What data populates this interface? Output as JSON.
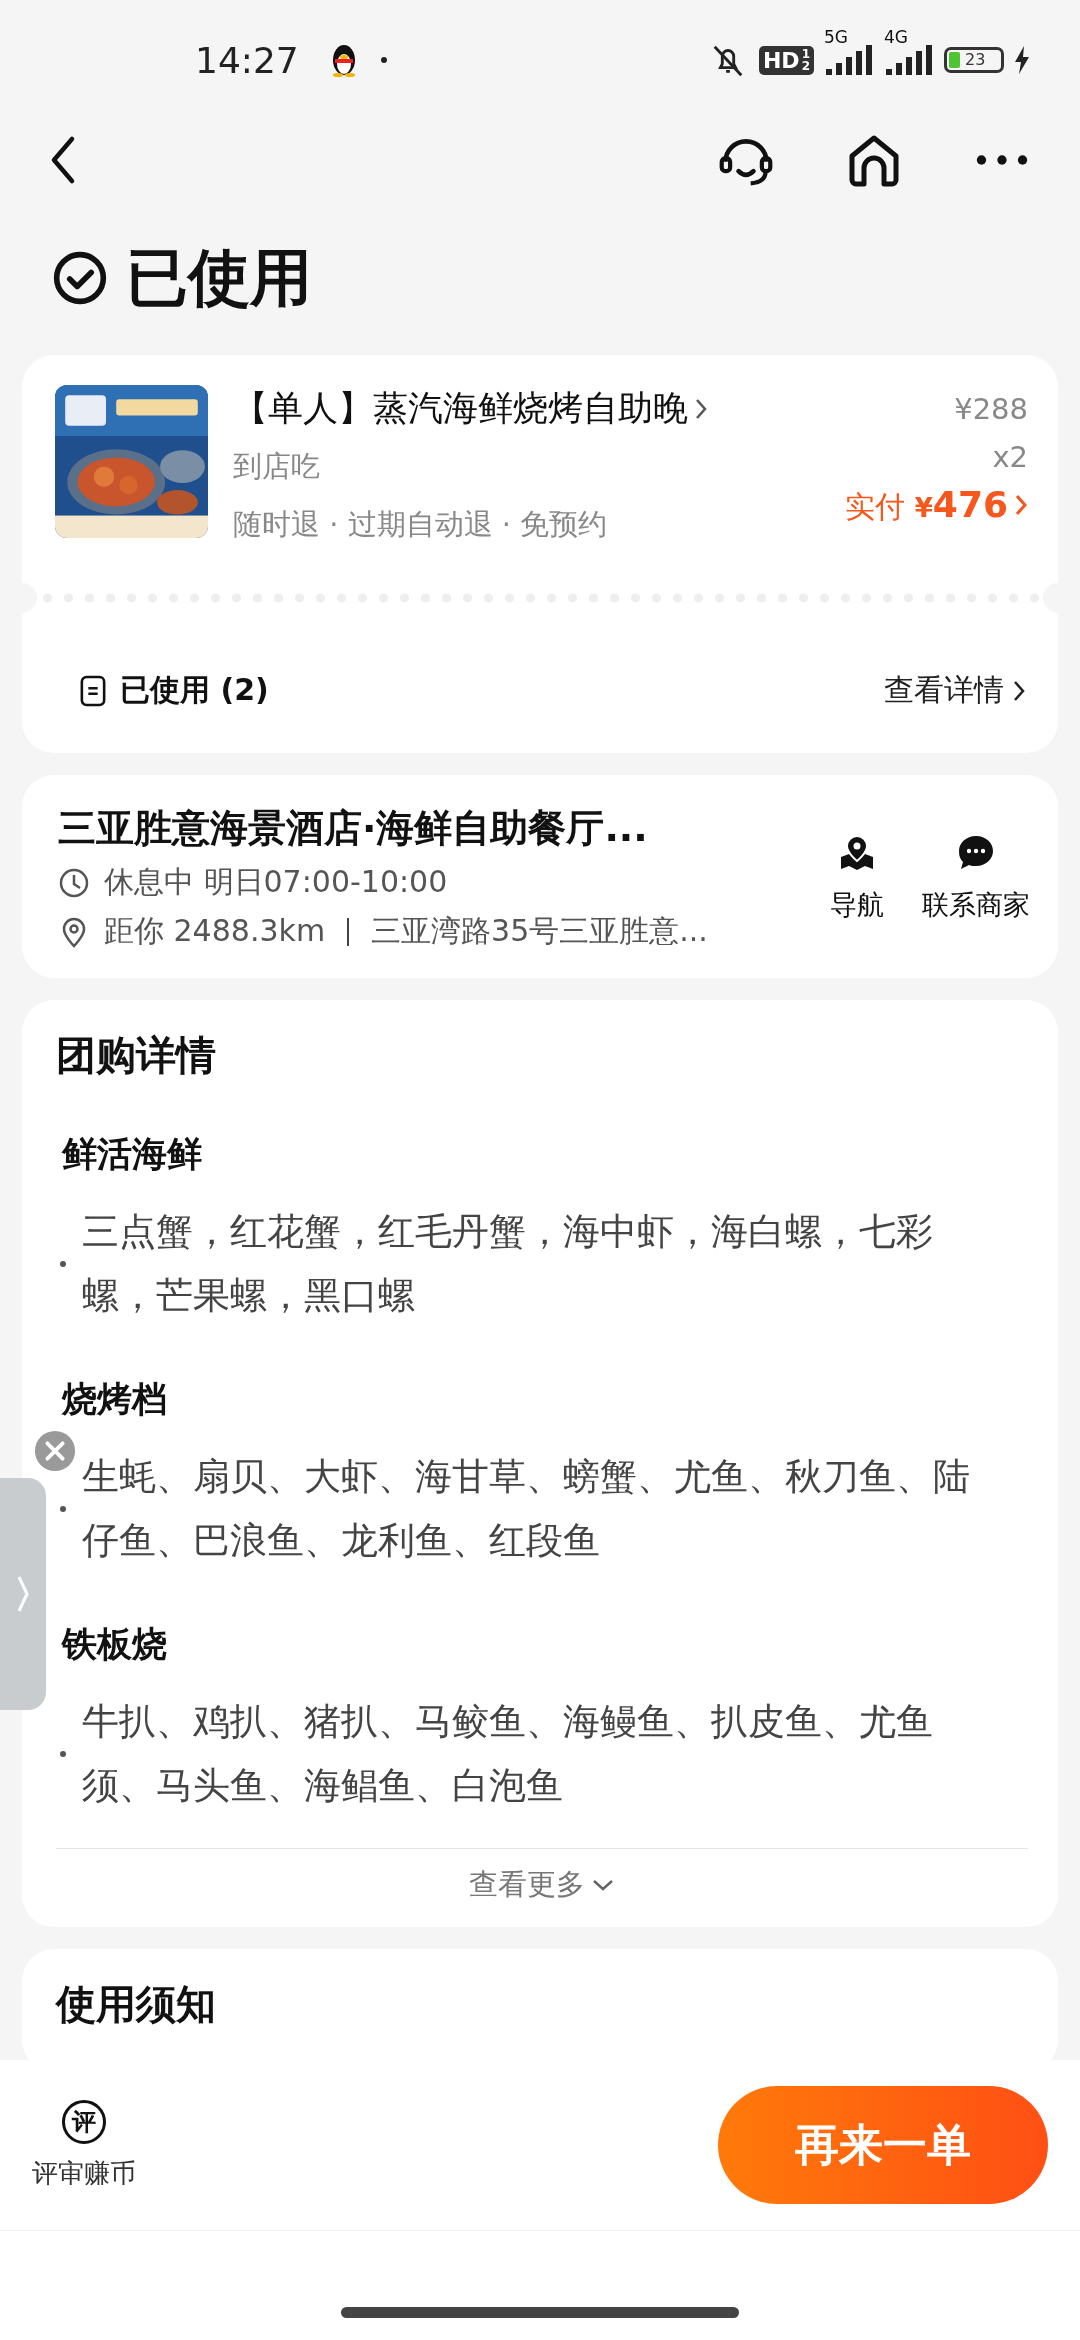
{
  "status_bar": {
    "time": "14:27",
    "hd_badge": "HD",
    "hd_digits": [
      "1",
      "2"
    ],
    "networks": [
      "5G",
      "4G"
    ],
    "battery": "23"
  },
  "header": {
    "status_title": "已使用"
  },
  "order": {
    "product_name": "【单人】蒸汽海鲜烧烤自助晚",
    "dine_type": "到店吃",
    "policies": "随时退 · 过期自动退 · 免预约",
    "unit_price": "¥288",
    "quantity": "x2",
    "paid_label": "实付",
    "paid_currency": "¥",
    "paid_amount": "476",
    "used_label": "已使用 (2)",
    "details_link": "查看详情"
  },
  "shop": {
    "name": "三亚胜意海景酒店·海鲜自助餐厅...",
    "hours_status": "休息中",
    "hours": "明日07:00-10:00",
    "distance": "距你 2488.3km",
    "address": "三亚湾路35号三亚胜意...",
    "actions": [
      {
        "kind": "navigate",
        "label": "导航"
      },
      {
        "kind": "chat",
        "label": "联系商家"
      }
    ]
  },
  "deal_details": {
    "title": "团购详情",
    "sections": [
      {
        "heading": "鲜活海鲜",
        "items": [
          "三点蟹，红花蟹，红毛丹蟹，海中虾，海白螺，七彩螺，芒果螺，黑口螺"
        ]
      },
      {
        "heading": "烧烤档",
        "items": [
          "生蚝、扇贝、大虾、海甘草、螃蟹、尤鱼、秋刀鱼、陆仔鱼、巴浪鱼、龙利鱼、红段鱼"
        ]
      },
      {
        "heading": "铁板烧",
        "items": [
          "牛扒、鸡扒、猪扒、马鲛鱼、海鳗鱼、扒皮鱼、尤鱼须、马头鱼、海鲳鱼、白泡鱼"
        ]
      }
    ],
    "more": "查看更多"
  },
  "usage_notes": {
    "title": "使用须知"
  },
  "bottom_bar": {
    "review_icon_char": "评",
    "review_label": "评审赚币",
    "reorder_button": "再来一单"
  }
}
